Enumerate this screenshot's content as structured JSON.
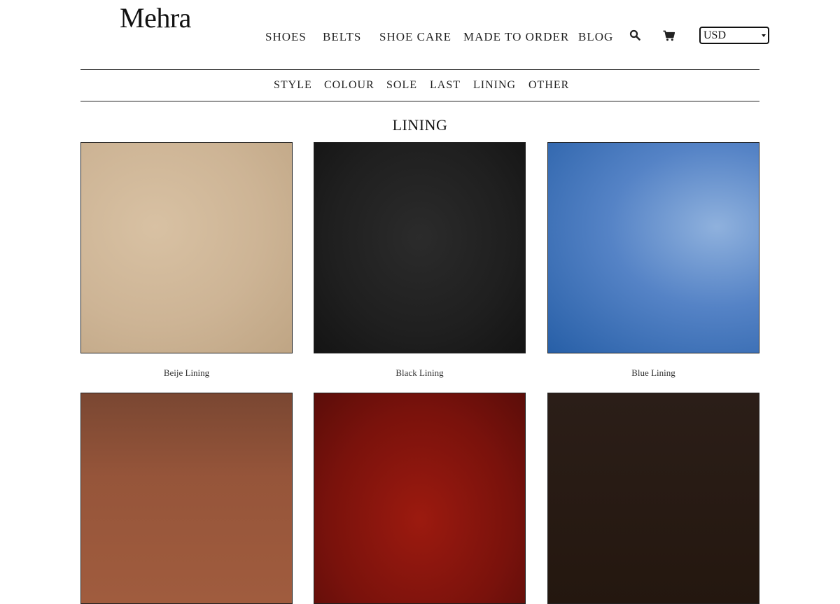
{
  "brand": {
    "logo_text": "Mehra"
  },
  "main_nav": {
    "items": [
      {
        "label": "SHOES"
      },
      {
        "label": "BELTS"
      },
      {
        "label": "SHOE CARE"
      },
      {
        "label": "MADE TO ORDER"
      },
      {
        "label": "BLOG"
      }
    ],
    "icons": [
      "search-icon",
      "cart-icon"
    ],
    "currency": {
      "selected": "USD"
    }
  },
  "sub_nav": {
    "items": [
      {
        "label": "STYLE"
      },
      {
        "label": "COLOUR"
      },
      {
        "label": "SOLE"
      },
      {
        "label": "LAST"
      },
      {
        "label": "LINING"
      },
      {
        "label": "OTHER"
      }
    ]
  },
  "page": {
    "title": "LINING"
  },
  "products": [
    {
      "name": "Beije Lining",
      "swatch_color": "#cdb495"
    },
    {
      "name": "Black Lining",
      "swatch_color": "#1f1f1f"
    },
    {
      "name": "Blue Lining",
      "swatch_color": "#4a7bc2"
    },
    {
      "name": "",
      "swatch_color": "#96553a"
    },
    {
      "name": "",
      "swatch_color": "#7a120c"
    },
    {
      "name": "",
      "swatch_color": "#2b1e18"
    }
  ]
}
